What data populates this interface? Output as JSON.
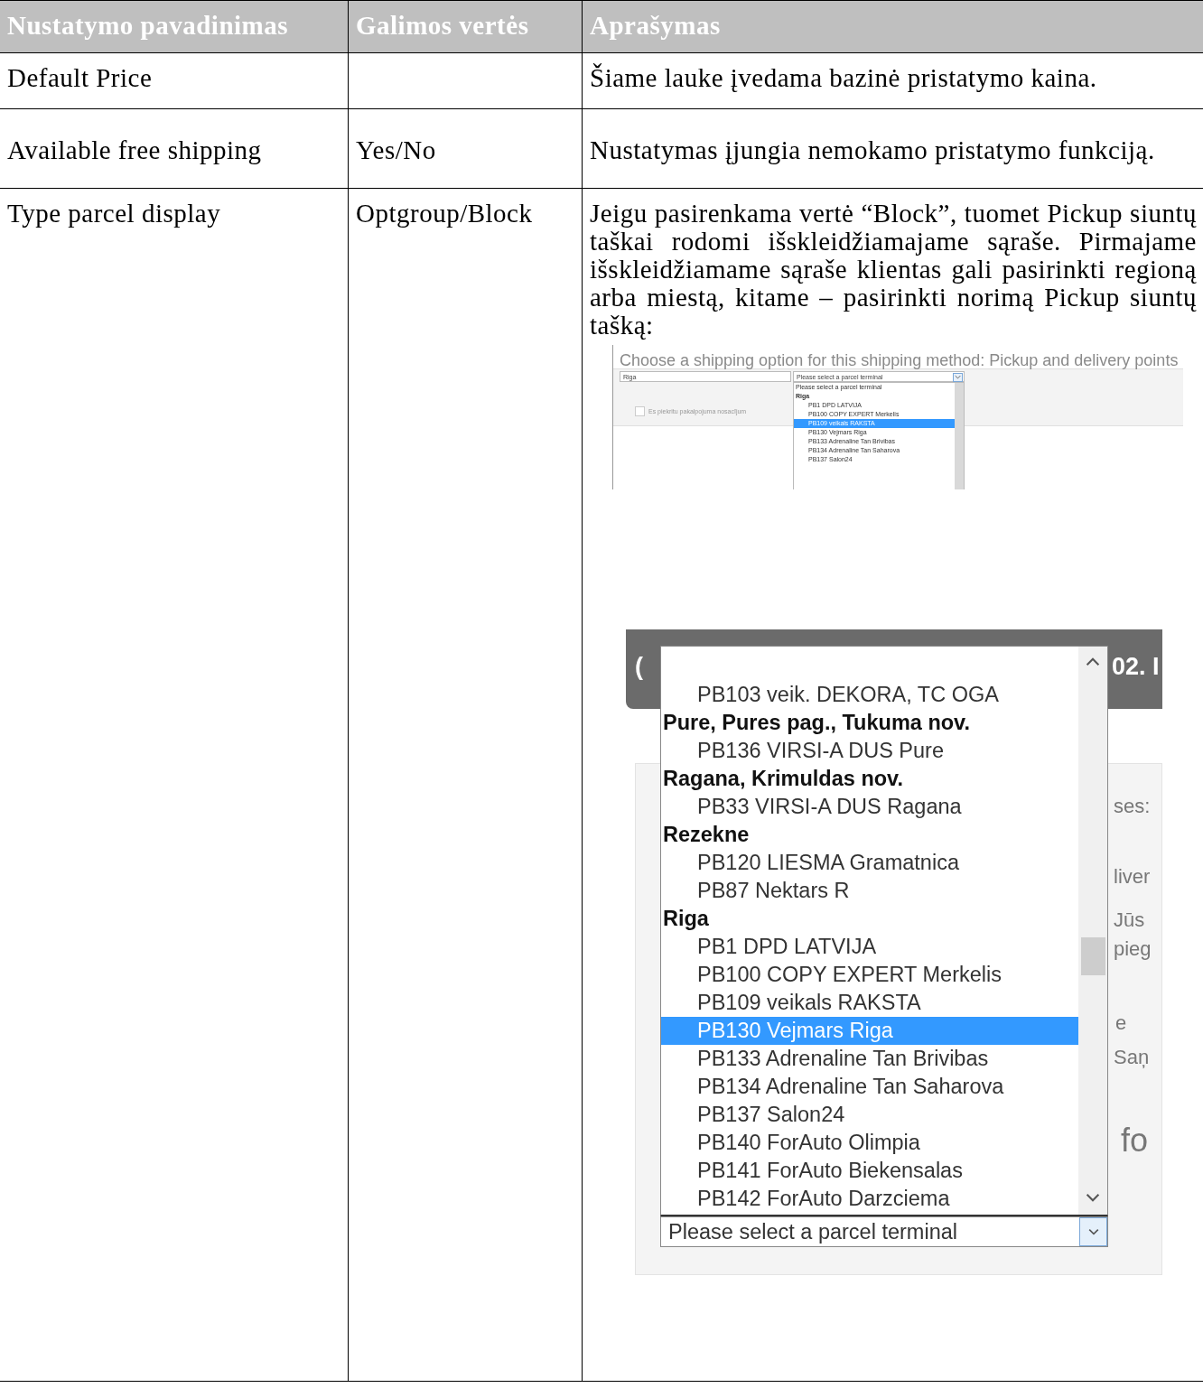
{
  "table": {
    "columns": [
      "Nustatymo pavadinimas",
      "Galimos vertės",
      "Aprašymas"
    ],
    "rows": [
      {
        "name": "Default Price",
        "description": "Šiame lauke įvedama bazinė pristatymo kaina."
      },
      {
        "name": "Available free shipping",
        "values": "Yes/No",
        "description": "Nustatymas įjungia nemokamo pristatymo funkciją."
      },
      {
        "name": "Type parcel display",
        "values": "Optgroup/Block",
        "description": "Jeigu pasirenkama vertė “Block”, tuomet Pickup siuntų taškai rodomi išskleidžiamajame sąraše. Pirmajame išskleidžiamame sąraše klientas gali pasirinkti regioną arba miestą, kitame – pasirinkti norimą Pickup siuntų tašką:",
        "screenshots": [
          {
            "kind": "small",
            "heading": "Choose a shipping option for this shipping method: Pickup and delivery points",
            "city_select": "Riga",
            "terminal_select": "Please select a parcel terminal",
            "options": [
              {
                "kind": "option",
                "label": "Please select a parcel terminal",
                "selected": false
              },
              {
                "kind": "group",
                "label": "Riga"
              },
              {
                "kind": "option",
                "label": "PB1 DPD LATVIJA",
                "selected": false
              },
              {
                "kind": "option",
                "label": "PB100 COPY EXPERT Merkelis",
                "selected": false
              },
              {
                "kind": "option",
                "label": "PB109 veikals RAKSTA",
                "selected": true
              },
              {
                "kind": "option",
                "label": "PB130 Vejmars Riga",
                "selected": false
              },
              {
                "kind": "option",
                "label": "PB133 Adrenaline Tan Brivibas",
                "selected": false
              },
              {
                "kind": "option",
                "label": "PB134 Adrenaline Tan Saharova",
                "selected": false
              },
              {
                "kind": "option",
                "label": "PB137 Salon24",
                "selected": false
              }
            ],
            "checkbox": {
              "label": "Es piekritu pakalpojuma nosacījum",
              "checked": false
            }
          },
          {
            "kind": "large",
            "header_fragments": [
              "(",
              "02. I"
            ],
            "options": [
              {
                "kind": "option",
                "label": "PB103 veik. DEKORA, TC OGA",
                "selected": false
              },
              {
                "kind": "group",
                "label": "Pure, Pures pag., Tukuma nov."
              },
              {
                "kind": "option",
                "label": "PB136 VIRSI-A DUS Pure",
                "selected": false
              },
              {
                "kind": "group",
                "label": "Ragana, Krimuldas nov."
              },
              {
                "kind": "option",
                "label": "PB33 VIRSI-A DUS Ragana",
                "selected": false
              },
              {
                "kind": "group",
                "label": "Rezekne"
              },
              {
                "kind": "option",
                "label": "PB120 LIESMA Gramatnica",
                "selected": false
              },
              {
                "kind": "option",
                "label": "PB87 Nektars R",
                "selected": false
              },
              {
                "kind": "group",
                "label": "Riga"
              },
              {
                "kind": "option",
                "label": "PB1 DPD LATVIJA",
                "selected": false
              },
              {
                "kind": "option",
                "label": "PB100 COPY EXPERT Merkelis",
                "selected": false
              },
              {
                "kind": "option",
                "label": "PB109 veikals RAKSTA",
                "selected": false
              },
              {
                "kind": "option",
                "label": "PB130 Vejmars Riga",
                "selected": true
              },
              {
                "kind": "option",
                "label": "PB133 Adrenaline Tan Brivibas",
                "selected": false
              },
              {
                "kind": "option",
                "label": "PB134 Adrenaline Tan Saharova",
                "selected": false
              },
              {
                "kind": "option",
                "label": "PB137 Salon24",
                "selected": false
              },
              {
                "kind": "option",
                "label": "PB140 ForAuto Olimpia",
                "selected": false
              },
              {
                "kind": "option",
                "label": "PB141 ForAuto Biekensalas",
                "selected": false
              },
              {
                "kind": "option",
                "label": "PB142 ForAuto Darzciema",
                "selected": false
              }
            ],
            "side_fragments": [
              "ses:",
              "liver",
              "Jūs",
              "pieg",
              "e",
              "Saņ",
              "fo"
            ],
            "select": "Please select a parcel terminal"
          }
        ]
      }
    ]
  }
}
